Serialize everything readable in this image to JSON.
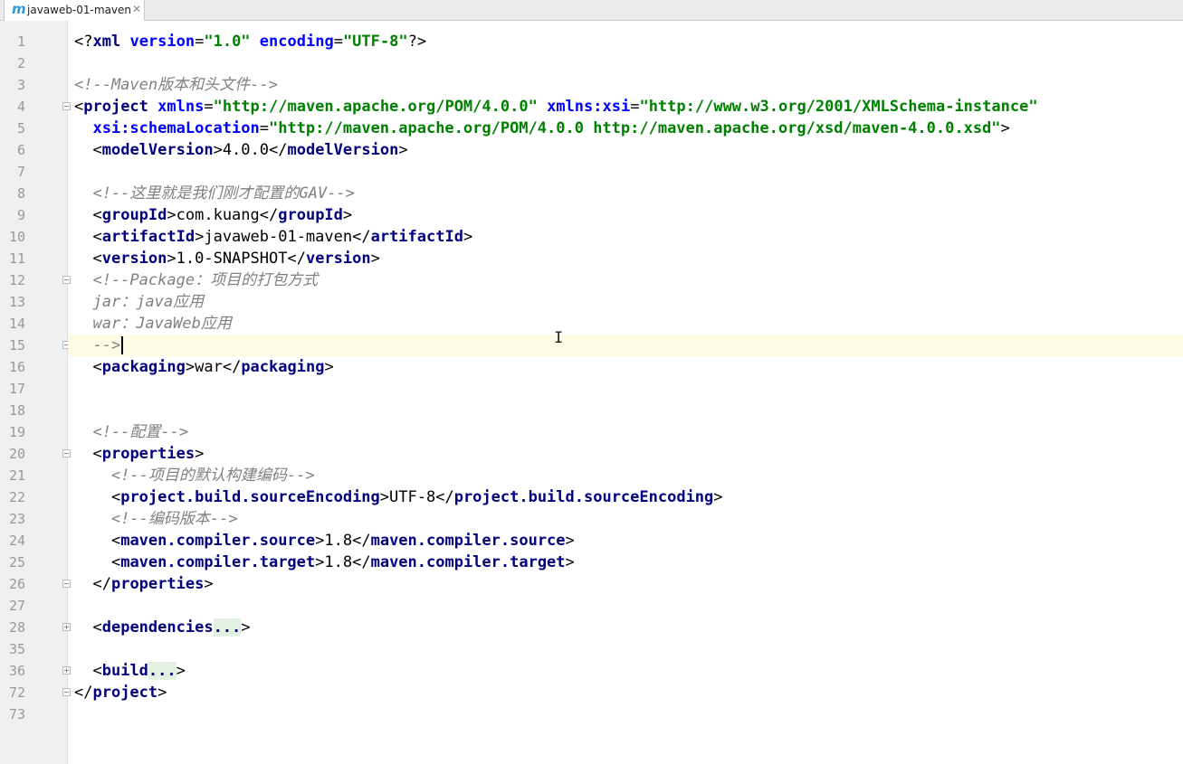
{
  "tab": {
    "icon": "maven-m-icon",
    "icon_glyph": "m",
    "label": "javaweb-01-maven",
    "close_glyph": "✕"
  },
  "editor": {
    "lines": [
      {
        "n": "1",
        "fold": "",
        "tokens": [
          {
            "t": "<?",
            "c": "bracket"
          },
          {
            "t": "xml",
            "c": "tag"
          },
          {
            "t": " ",
            "c": "text"
          },
          {
            "t": "version",
            "c": "attr"
          },
          {
            "t": "=",
            "c": "text"
          },
          {
            "t": "\"1.0\"",
            "c": "val"
          },
          {
            "t": " ",
            "c": "text"
          },
          {
            "t": "encoding",
            "c": "attr"
          },
          {
            "t": "=",
            "c": "text"
          },
          {
            "t": "\"UTF-8\"",
            "c": "val"
          },
          {
            "t": "?>",
            "c": "bracket"
          }
        ]
      },
      {
        "n": "2",
        "fold": "",
        "tokens": []
      },
      {
        "n": "3",
        "fold": "",
        "tokens": [
          {
            "t": "<!--Maven版本和头文件-->",
            "c": "comment"
          }
        ]
      },
      {
        "n": "4",
        "fold": "minus",
        "tokens": [
          {
            "t": "<",
            "c": "bracket"
          },
          {
            "t": "project",
            "c": "tag"
          },
          {
            "t": " ",
            "c": "text"
          },
          {
            "t": "xmlns",
            "c": "attr"
          },
          {
            "t": "=",
            "c": "text"
          },
          {
            "t": "\"http://maven.apache.org/POM/4.0.0\"",
            "c": "val"
          },
          {
            "t": " ",
            "c": "text"
          },
          {
            "t": "xmlns:xsi",
            "c": "attr"
          },
          {
            "t": "=",
            "c": "text"
          },
          {
            "t": "\"http://www.w3.org/2001/XMLSchema-instance\"",
            "c": "val"
          }
        ]
      },
      {
        "n": "5",
        "fold": "",
        "tokens": [
          {
            "t": "  ",
            "c": "text"
          },
          {
            "t": "xsi:schemaLocation",
            "c": "attr"
          },
          {
            "t": "=",
            "c": "text"
          },
          {
            "t": "\"http://maven.apache.org/POM/4.0.0 http://maven.apache.org/xsd/maven-4.0.0.xsd\"",
            "c": "val"
          },
          {
            "t": ">",
            "c": "bracket"
          }
        ]
      },
      {
        "n": "6",
        "fold": "",
        "tokens": [
          {
            "t": "  ",
            "c": "text"
          },
          {
            "t": "<",
            "c": "bracket"
          },
          {
            "t": "modelVersion",
            "c": "tag"
          },
          {
            "t": ">",
            "c": "bracket"
          },
          {
            "t": "4.0.0",
            "c": "text"
          },
          {
            "t": "</",
            "c": "bracket"
          },
          {
            "t": "modelVersion",
            "c": "tag"
          },
          {
            "t": ">",
            "c": "bracket"
          }
        ]
      },
      {
        "n": "7",
        "fold": "",
        "tokens": []
      },
      {
        "n": "8",
        "fold": "",
        "tokens": [
          {
            "t": "  ",
            "c": "text"
          },
          {
            "t": "<!--这里就是我们刚才配置的GAV-->",
            "c": "comment"
          }
        ]
      },
      {
        "n": "9",
        "fold": "",
        "tokens": [
          {
            "t": "  ",
            "c": "text"
          },
          {
            "t": "<",
            "c": "bracket"
          },
          {
            "t": "groupId",
            "c": "tag"
          },
          {
            "t": ">",
            "c": "bracket"
          },
          {
            "t": "com.kuang",
            "c": "text"
          },
          {
            "t": "</",
            "c": "bracket"
          },
          {
            "t": "groupId",
            "c": "tag"
          },
          {
            "t": ">",
            "c": "bracket"
          }
        ]
      },
      {
        "n": "10",
        "fold": "",
        "tokens": [
          {
            "t": "  ",
            "c": "text"
          },
          {
            "t": "<",
            "c": "bracket"
          },
          {
            "t": "artifactId",
            "c": "tag"
          },
          {
            "t": ">",
            "c": "bracket"
          },
          {
            "t": "javaweb-01-maven",
            "c": "text"
          },
          {
            "t": "</",
            "c": "bracket"
          },
          {
            "t": "artifactId",
            "c": "tag"
          },
          {
            "t": ">",
            "c": "bracket"
          }
        ]
      },
      {
        "n": "11",
        "fold": "",
        "tokens": [
          {
            "t": "  ",
            "c": "text"
          },
          {
            "t": "<",
            "c": "bracket"
          },
          {
            "t": "version",
            "c": "tag"
          },
          {
            "t": ">",
            "c": "bracket"
          },
          {
            "t": "1.0-SNAPSHOT",
            "c": "text"
          },
          {
            "t": "</",
            "c": "bracket"
          },
          {
            "t": "version",
            "c": "tag"
          },
          {
            "t": ">",
            "c": "bracket"
          }
        ]
      },
      {
        "n": "12",
        "fold": "minus",
        "tokens": [
          {
            "t": "  ",
            "c": "text"
          },
          {
            "t": "<!--Package：项目的打包方式",
            "c": "comment"
          }
        ]
      },
      {
        "n": "13",
        "fold": "",
        "tokens": [
          {
            "t": "  ",
            "c": "text"
          },
          {
            "t": "jar：java应用",
            "c": "comment"
          }
        ]
      },
      {
        "n": "14",
        "fold": "",
        "tokens": [
          {
            "t": "  ",
            "c": "text"
          },
          {
            "t": "war：JavaWeb应用",
            "c": "comment"
          }
        ]
      },
      {
        "n": "15",
        "fold": "minus",
        "current": true,
        "caret": true,
        "tokens": [
          {
            "t": "  ",
            "c": "text"
          },
          {
            "t": "-->",
            "c": "comment"
          }
        ]
      },
      {
        "n": "16",
        "fold": "",
        "tokens": [
          {
            "t": "  ",
            "c": "text"
          },
          {
            "t": "<",
            "c": "bracket"
          },
          {
            "t": "packaging",
            "c": "tag"
          },
          {
            "t": ">",
            "c": "bracket"
          },
          {
            "t": "war",
            "c": "text"
          },
          {
            "t": "</",
            "c": "bracket"
          },
          {
            "t": "packaging",
            "c": "tag"
          },
          {
            "t": ">",
            "c": "bracket"
          }
        ]
      },
      {
        "n": "17",
        "fold": "",
        "tokens": []
      },
      {
        "n": "18",
        "fold": "",
        "tokens": []
      },
      {
        "n": "19",
        "fold": "",
        "tokens": [
          {
            "t": "  ",
            "c": "text"
          },
          {
            "t": "<!--配置-->",
            "c": "comment"
          }
        ]
      },
      {
        "n": "20",
        "fold": "minus",
        "tokens": [
          {
            "t": "  ",
            "c": "text"
          },
          {
            "t": "<",
            "c": "bracket"
          },
          {
            "t": "properties",
            "c": "tag"
          },
          {
            "t": ">",
            "c": "bracket"
          }
        ]
      },
      {
        "n": "21",
        "fold": "",
        "tokens": [
          {
            "t": "    ",
            "c": "text"
          },
          {
            "t": "<!--项目的默认构建编码-->",
            "c": "comment"
          }
        ]
      },
      {
        "n": "22",
        "fold": "",
        "tokens": [
          {
            "t": "    ",
            "c": "text"
          },
          {
            "t": "<",
            "c": "bracket"
          },
          {
            "t": "project.build.sourceEncoding",
            "c": "tag"
          },
          {
            "t": ">",
            "c": "bracket"
          },
          {
            "t": "UTF-8",
            "c": "text"
          },
          {
            "t": "</",
            "c": "bracket"
          },
          {
            "t": "project.build.sourceEncoding",
            "c": "tag"
          },
          {
            "t": ">",
            "c": "bracket"
          }
        ]
      },
      {
        "n": "23",
        "fold": "",
        "tokens": [
          {
            "t": "    ",
            "c": "text"
          },
          {
            "t": "<!--编码版本-->",
            "c": "comment"
          }
        ]
      },
      {
        "n": "24",
        "fold": "",
        "tokens": [
          {
            "t": "    ",
            "c": "text"
          },
          {
            "t": "<",
            "c": "bracket"
          },
          {
            "t": "maven.compiler.source",
            "c": "tag"
          },
          {
            "t": ">",
            "c": "bracket"
          },
          {
            "t": "1.8",
            "c": "text"
          },
          {
            "t": "</",
            "c": "bracket"
          },
          {
            "t": "maven.compiler.source",
            "c": "tag"
          },
          {
            "t": ">",
            "c": "bracket"
          }
        ]
      },
      {
        "n": "25",
        "fold": "",
        "tokens": [
          {
            "t": "    ",
            "c": "text"
          },
          {
            "t": "<",
            "c": "bracket"
          },
          {
            "t": "maven.compiler.target",
            "c": "tag"
          },
          {
            "t": ">",
            "c": "bracket"
          },
          {
            "t": "1.8",
            "c": "text"
          },
          {
            "t": "</",
            "c": "bracket"
          },
          {
            "t": "maven.compiler.target",
            "c": "tag"
          },
          {
            "t": ">",
            "c": "bracket"
          }
        ]
      },
      {
        "n": "26",
        "fold": "minus",
        "tokens": [
          {
            "t": "  ",
            "c": "text"
          },
          {
            "t": "</",
            "c": "bracket"
          },
          {
            "t": "properties",
            "c": "tag"
          },
          {
            "t": ">",
            "c": "bracket"
          }
        ]
      },
      {
        "n": "27",
        "fold": "",
        "tokens": []
      },
      {
        "n": "28",
        "fold": "plus",
        "tokens": [
          {
            "t": "  ",
            "c": "text"
          },
          {
            "t": "<",
            "c": "bracket"
          },
          {
            "t": "dependencies",
            "c": "tag"
          },
          {
            "t": "...",
            "c": "fold"
          },
          {
            "t": ">",
            "c": "bracket"
          }
        ]
      },
      {
        "n": "35",
        "fold": "",
        "tokens": []
      },
      {
        "n": "36",
        "fold": "plus",
        "tokens": [
          {
            "t": "  ",
            "c": "text"
          },
          {
            "t": "<",
            "c": "bracket"
          },
          {
            "t": "build",
            "c": "tag"
          },
          {
            "t": "...",
            "c": "fold"
          },
          {
            "t": ">",
            "c": "bracket"
          }
        ]
      },
      {
        "n": "72",
        "fold": "minus",
        "tokens": [
          {
            "t": "</",
            "c": "bracket"
          },
          {
            "t": "project",
            "c": "tag"
          },
          {
            "t": ">",
            "c": "bracket"
          }
        ]
      },
      {
        "n": "73",
        "fold": "",
        "tokens": []
      }
    ]
  }
}
